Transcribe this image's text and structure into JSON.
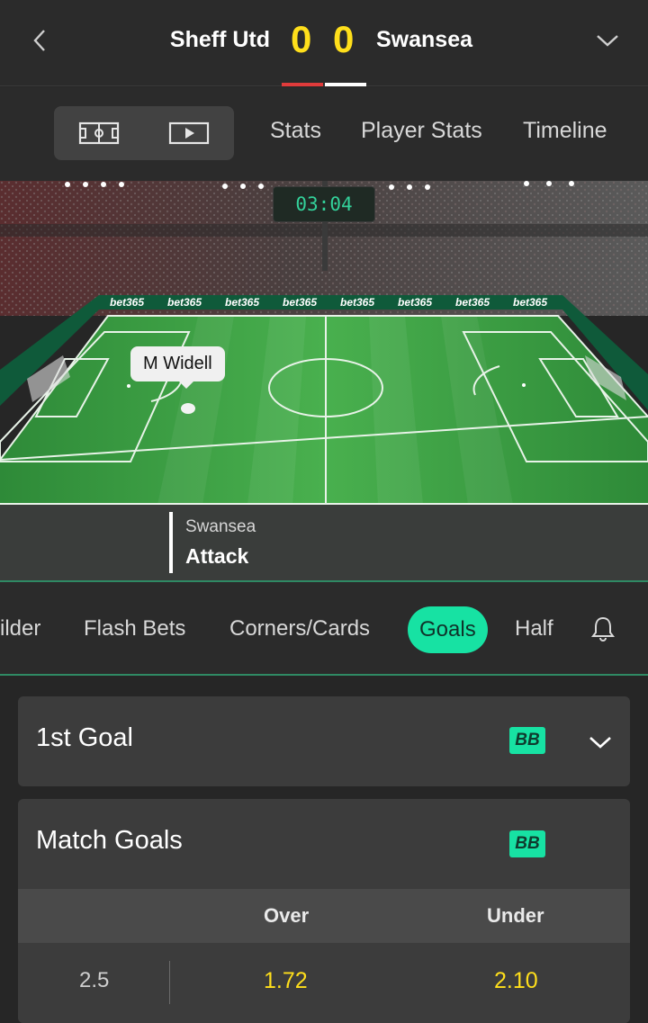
{
  "header": {
    "home_team": "Sheff Utd",
    "away_team": "Swansea",
    "home_score": "0",
    "away_score": "0",
    "home_color": "#e03b3b",
    "away_color": "#ffffff",
    "score_color": "#ffdf1b"
  },
  "subnav": {
    "tabs": [
      "Stats",
      "Player Stats",
      "Timeline"
    ]
  },
  "pitch": {
    "timer": "03:04",
    "player_tooltip": "M Widell",
    "ad_text": "bet365",
    "possession_team": "Swansea",
    "possession_state": "Attack"
  },
  "market_tabs": {
    "items": [
      "ilder",
      "Flash Bets",
      "Corners/Cards",
      "Goals",
      "Half"
    ],
    "active": "Goals",
    "accent": "#17e2a3"
  },
  "markets": {
    "first_goal": {
      "title": "1st Goal",
      "badge": "BB"
    },
    "match_goals": {
      "title": "Match Goals",
      "badge": "BB",
      "columns": [
        "Over",
        "Under"
      ],
      "rows": [
        {
          "line": "2.5",
          "over": "1.72",
          "under": "2.10"
        }
      ]
    }
  }
}
